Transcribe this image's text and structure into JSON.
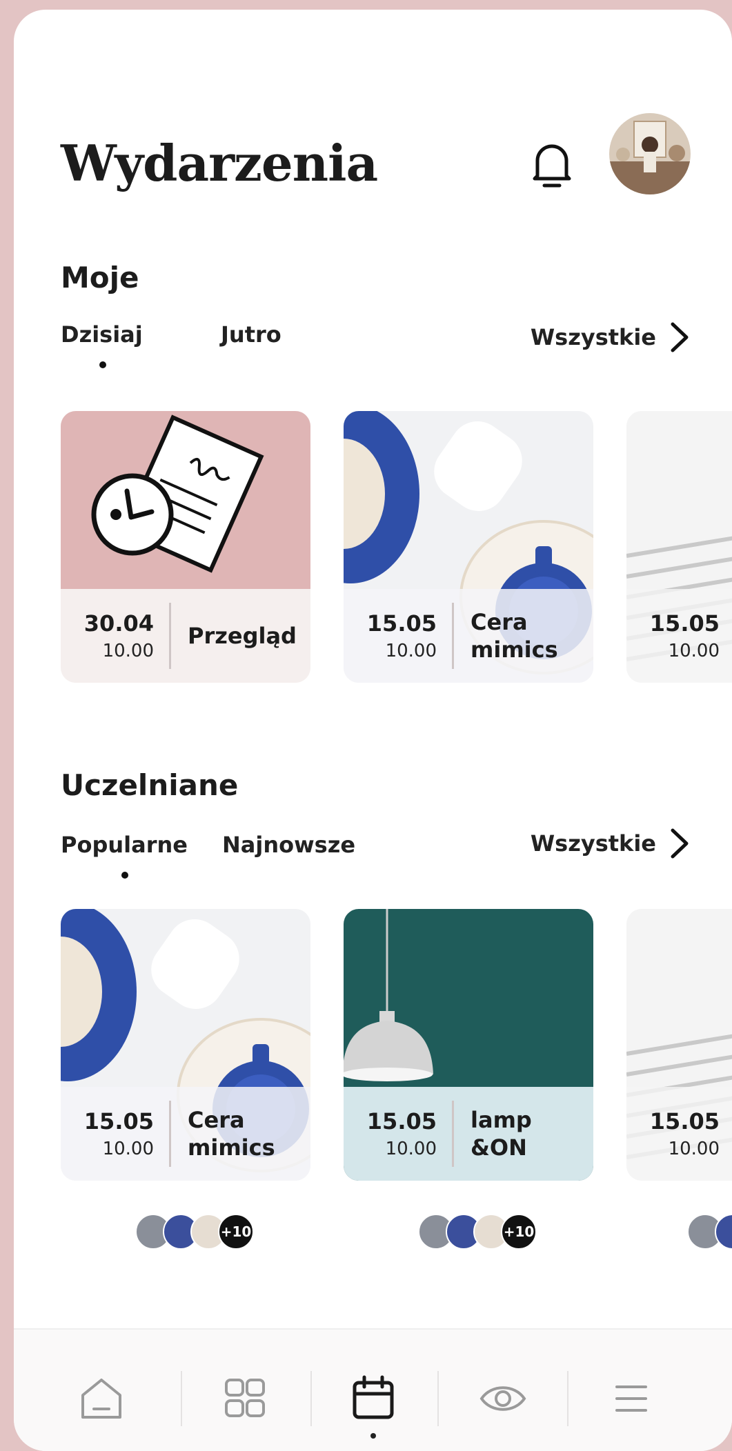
{
  "header": {
    "title": "Wydarzenia",
    "notification_icon": "bell-icon",
    "avatar_icon": "user-avatar"
  },
  "mine": {
    "title": "Moje",
    "tabs": [
      "Dzisiaj",
      "Jutro"
    ],
    "active_tab": "Dzisiaj",
    "all_label": "Wszystkie",
    "cards": [
      {
        "date": "30.04",
        "time": "10.00",
        "name": "Przegląd"
      },
      {
        "date": "15.05",
        "time": "10.00",
        "name": "Cera\nmimics"
      },
      {
        "date": "15.05",
        "time": "10.00",
        "name": ""
      }
    ]
  },
  "recommended": {
    "title": "Uczelniane",
    "tabs": [
      "Popularne",
      "Najnowsze"
    ],
    "active_tab": "Popularne",
    "all_label": "Wszystkie",
    "cards": [
      {
        "date": "15.05",
        "time": "10.00",
        "name": "Cera\nmimics",
        "attendees_more": "+10"
      },
      {
        "date": "15.05",
        "time": "10.00",
        "name": "lamp\n&ON",
        "attendees_more": "+10"
      },
      {
        "date": "15.05",
        "time": "10.00",
        "name": ""
      }
    ]
  },
  "nav": {
    "items": [
      "home-icon",
      "grid-icon",
      "calendar-icon",
      "eye-icon",
      "menu-icon"
    ],
    "active": "calendar-icon"
  },
  "colors": {
    "accent_pink": "#e3c4c4",
    "teal": "#1f5c5a",
    "blue": "#2f4fa8"
  }
}
